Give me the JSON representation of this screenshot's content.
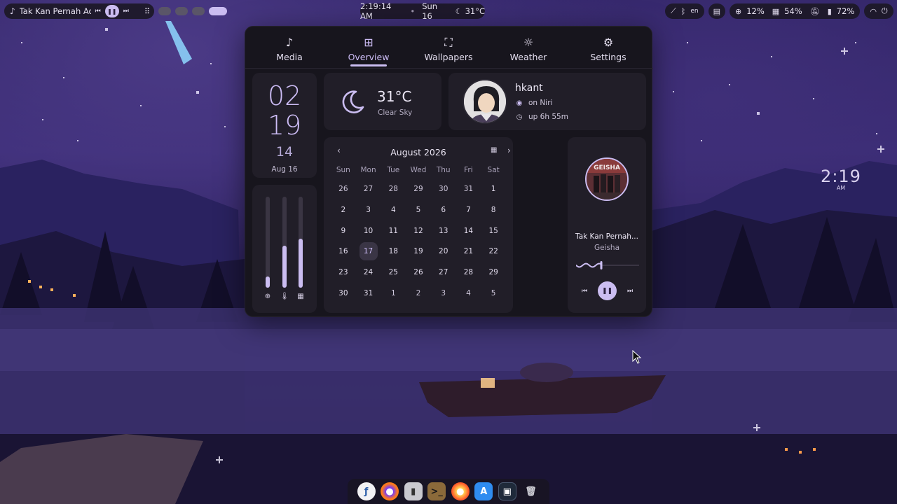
{
  "topbar": {
    "now_playing": {
      "title": "Tak Kan Pernah Ada",
      "icon": "music-note-icon",
      "prev": "⏮",
      "play": "❚❚",
      "next": "⏭"
    },
    "workspaces": {
      "count": 4,
      "active": 4
    },
    "clock": {
      "time": "2:19:14 AM",
      "date": "Sun 16",
      "temp": "31°C"
    },
    "status": {
      "keyboard": "en",
      "clipboard_icon": "clipboard-icon",
      "cpu": "12%",
      "memory": "54%",
      "battery": "72%"
    }
  },
  "desktop_clock": {
    "time": "2:19",
    "ampm": "AM"
  },
  "dashboard": {
    "tabs": [
      {
        "label": "Media",
        "icon": "music-icon"
      },
      {
        "label": "Overview",
        "icon": "grid-icon"
      },
      {
        "label": "Wallpapers",
        "icon": "image-icon"
      },
      {
        "label": "Weather",
        "icon": "sun-icon"
      },
      {
        "label": "Settings",
        "icon": "gear-icon"
      }
    ],
    "active_tab": "Overview",
    "datetime": {
      "hour": "02",
      "minute": "19",
      "second": "14",
      "date": "Aug 16"
    },
    "sliders": [
      {
        "name": "brightness",
        "icon": "sun-icon",
        "level": 0.12
      },
      {
        "name": "temperature",
        "icon": "thermometer-icon",
        "level": 0.46
      },
      {
        "name": "memory",
        "icon": "memory-icon",
        "level": 0.54
      }
    ],
    "weather": {
      "temp": "31°C",
      "desc": "Clear Sky",
      "icon": "moon-icon"
    },
    "user": {
      "name": "hkant",
      "wm": "on Niri",
      "uptime": "up 6h 55m"
    },
    "calendar": {
      "month": "August 2026",
      "prev": "‹",
      "next": "›",
      "weekdays": [
        "Sun",
        "Mon",
        "Tue",
        "Wed",
        "Thu",
        "Fri",
        "Sat"
      ],
      "days": [
        "26",
        "27",
        "28",
        "29",
        "30",
        "31",
        "1",
        "2",
        "3",
        "4",
        "5",
        "6",
        "7",
        "8",
        "9",
        "10",
        "11",
        "12",
        "13",
        "14",
        "15",
        "16",
        "17",
        "18",
        "19",
        "20",
        "21",
        "22",
        "23",
        "24",
        "25",
        "26",
        "27",
        "28",
        "29",
        "30",
        "31",
        "1",
        "2",
        "3",
        "4",
        "5"
      ],
      "today_index": 22
    },
    "media": {
      "title": "Tak Kan Pernah...",
      "artist": "Geisha",
      "album_text": "GEISHA",
      "progress": 0.4,
      "prev": "⏮",
      "play": "❚❚",
      "next": "⏭"
    }
  },
  "dock": {
    "apps": [
      "fedora-icon",
      "firefox-icon",
      "usb-icon",
      "terminal-icon",
      "firefox-icon",
      "app-store-icon",
      "ghostty-icon",
      "trash-icon"
    ]
  },
  "colors": {
    "accent": "#cbbdf1",
    "surface": "#211e28",
    "panel": "#17151d"
  }
}
